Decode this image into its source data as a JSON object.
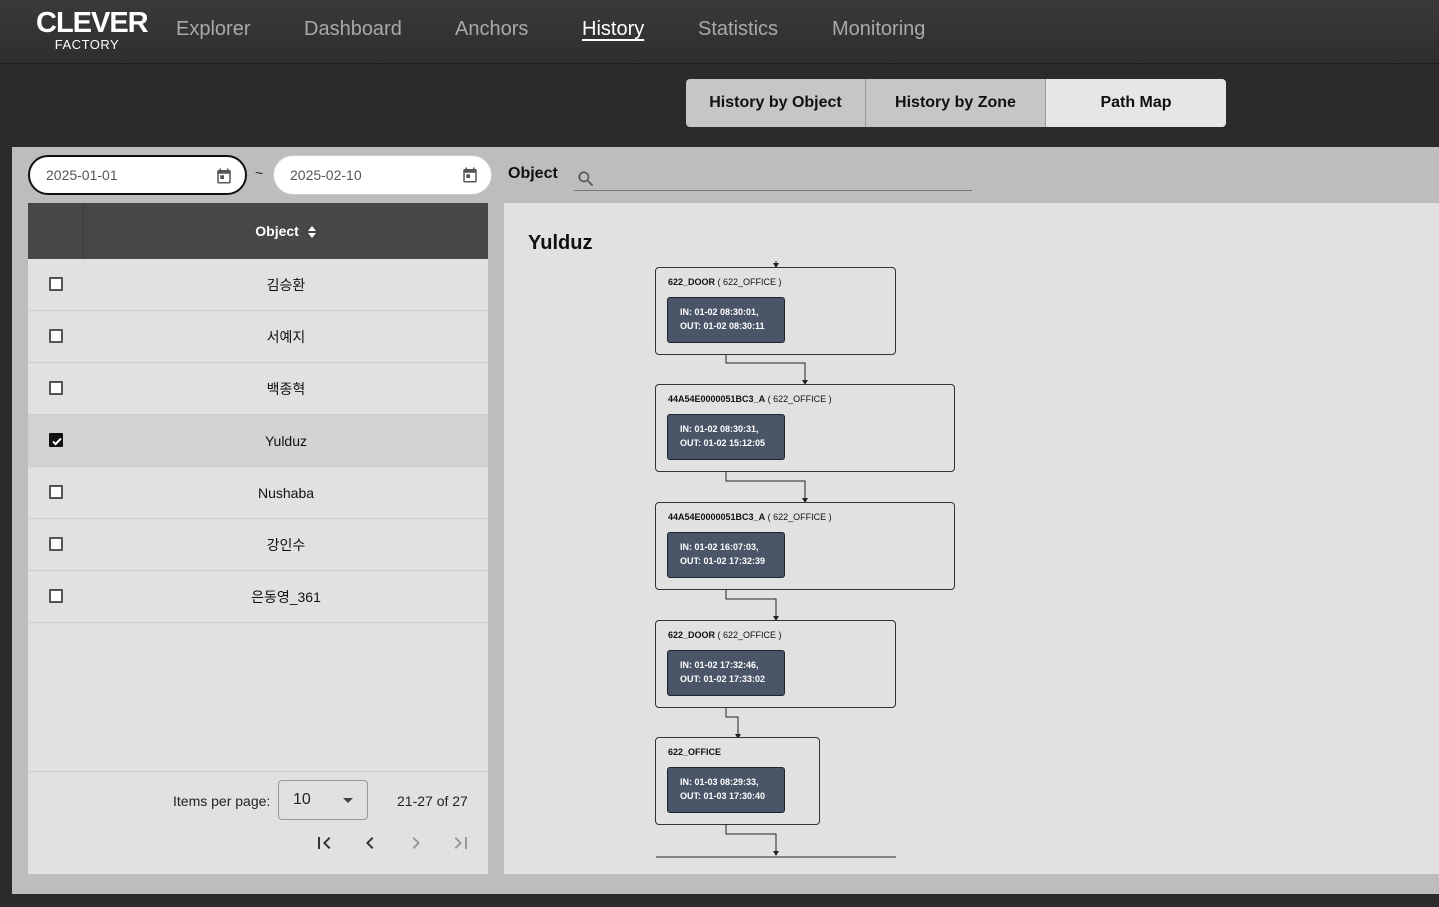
{
  "logo": {
    "line1": "CLEVER",
    "line2": "FACTORY"
  },
  "nav": [
    "Explorer",
    "Dashboard",
    "Anchors",
    "History",
    "Statistics",
    "Monitoring"
  ],
  "nav_active": "History",
  "subtabs": [
    "History by Object",
    "History by Zone",
    "Path Map"
  ],
  "subtab_active": "Path Map",
  "date_from": "2025-01-01",
  "date_to": "2025-02-10",
  "date_separator": "~",
  "object_search": {
    "label": "Object",
    "value": ""
  },
  "table": {
    "header": "Object",
    "rows": [
      {
        "name": "김승환",
        "checked": false
      },
      {
        "name": "서예지",
        "checked": false
      },
      {
        "name": "백종혁",
        "checked": false
      },
      {
        "name": "Yulduz",
        "checked": true
      },
      {
        "name": "Nushaba",
        "checked": false
      },
      {
        "name": "강인수",
        "checked": false
      },
      {
        "name": "은동영_361",
        "checked": false
      }
    ]
  },
  "pagination": {
    "items_per_page_label": "Items per page:",
    "items_per_page": "10",
    "range": "21-27 of 27"
  },
  "path_map": {
    "title": "Yulduz",
    "nodes": [
      {
        "name": "622_DOOR",
        "zone": " ( 622_OFFICE )",
        "in": "IN: 01-02 08:30:01,",
        "out": "OUT: 01-02 08:30:11"
      },
      {
        "name": "44A54E0000051BC3_A",
        "zone": " ( 622_OFFICE )",
        "in": "IN: 01-02 08:30:31,",
        "out": "OUT: 01-02 15:12:05"
      },
      {
        "name": "44A54E0000051BC3_A",
        "zone": " ( 622_OFFICE )",
        "in": "IN: 01-02 16:07:03,",
        "out": "OUT: 01-02 17:32:39"
      },
      {
        "name": "622_DOOR",
        "zone": " ( 622_OFFICE )",
        "in": "IN: 01-02 17:32:46,",
        "out": "OUT: 01-02 17:33:02"
      },
      {
        "name": "622_OFFICE",
        "zone": "",
        "in": "IN: 01-03 08:29:33,",
        "out": "OUT: 01-03 17:30:40"
      }
    ]
  }
}
